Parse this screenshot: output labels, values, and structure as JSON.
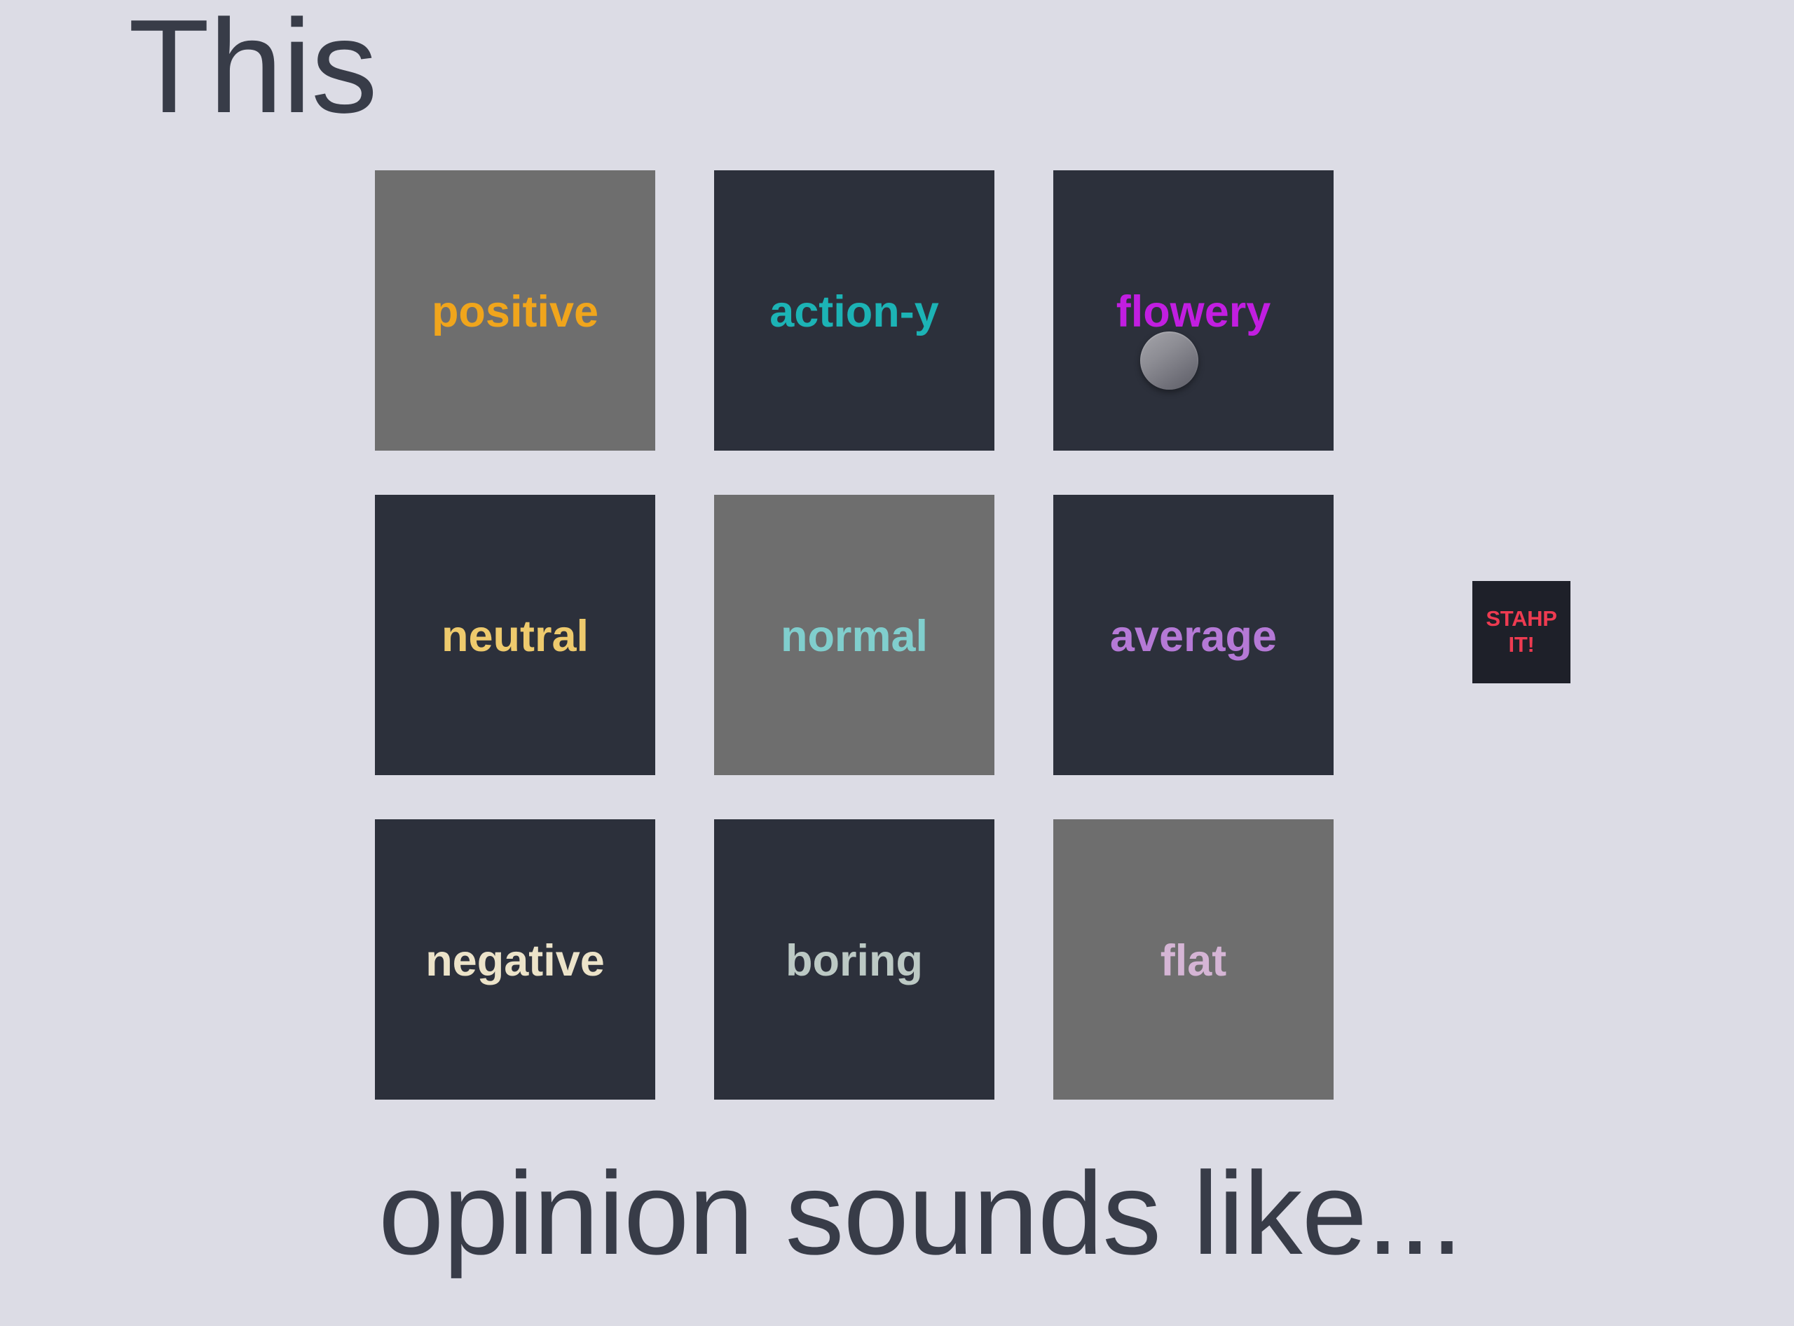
{
  "page": {
    "background_color": "#dcdce5",
    "text_color": "#383c48"
  },
  "headline": {
    "text": "This"
  },
  "caption": {
    "text": "opinion sounds like..."
  },
  "grid": {
    "rows": 3,
    "columns": 3,
    "tile_bg_dark": "#2c303b",
    "tile_bg_light": "#6e6e6e",
    "tiles": [
      {
        "label": "positive",
        "text_color": "#f0a51c",
        "tile_color": "#6e6e6e",
        "variant": "light"
      },
      {
        "label": "action-y",
        "text_color": "#1cb3b5",
        "tile_color": "#2c303b",
        "variant": "dark"
      },
      {
        "label": "flowery",
        "text_color": "#c11ee0",
        "tile_color": "#2c303b",
        "variant": "dark"
      },
      {
        "label": "neutral",
        "text_color": "#eeca6d",
        "tile_color": "#2c303b",
        "variant": "dark"
      },
      {
        "label": "normal",
        "text_color": "#80cecd",
        "tile_color": "#6e6e6e",
        "variant": "light"
      },
      {
        "label": "average",
        "text_color": "#b579d6",
        "tile_color": "#2c303b",
        "variant": "dark"
      },
      {
        "label": "negative",
        "text_color": "#ece3c9",
        "tile_color": "#2c303b",
        "variant": "dark"
      },
      {
        "label": "boring",
        "text_color": "#bcc9c4",
        "tile_color": "#2c303b",
        "variant": "dark"
      },
      {
        "label": "flat",
        "text_color": "#d5b5d5",
        "tile_color": "#6e6e6e",
        "variant": "light"
      }
    ]
  },
  "cursor": {
    "icon": "circle-cursor-icon",
    "color_light": "#a5a5ab",
    "color_dark": "#5d5d66"
  },
  "stahp_button": {
    "line1": "STAHP",
    "line2": "IT!",
    "text_color": "#ee3b51",
    "background_color": "#1e2029"
  }
}
